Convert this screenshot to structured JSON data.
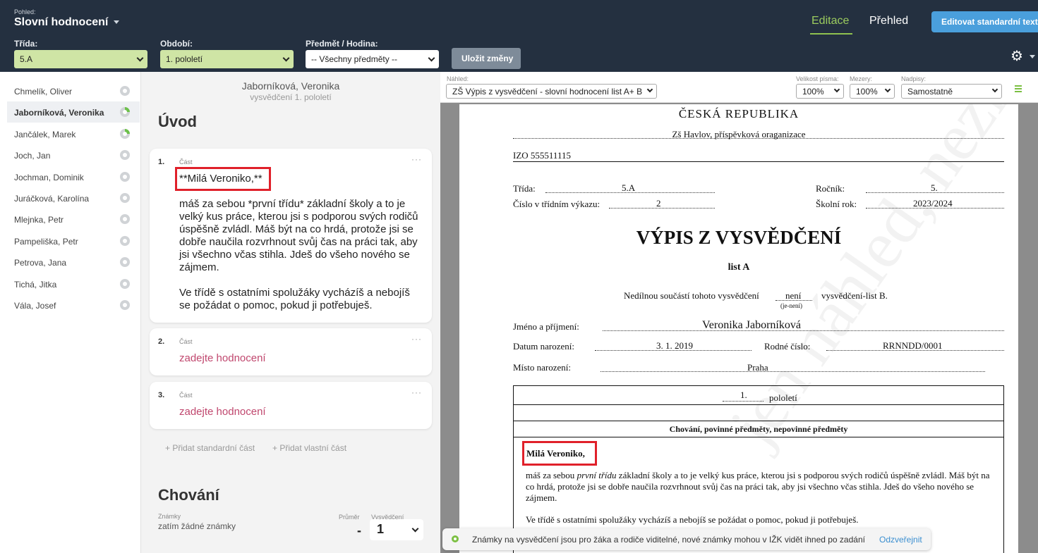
{
  "header": {
    "view_label": "Pohled:",
    "view_title": "Slovní hodnocení",
    "tab_edit": "Editace",
    "tab_overview": "Přehled",
    "btn_standard_texts": "Editovat standardní texty",
    "filters": {
      "class_label": "Třída:",
      "class_value": "5.A",
      "period_label": "Období:",
      "period_value": "1. pololetí",
      "subject_label": "Předmět / Hodina:",
      "subject_value": "-- Všechny předměty --"
    },
    "btn_save": "Uložit změny",
    "accent_green": "#8fc24f",
    "brand_blue": "#4a9fdc"
  },
  "students": [
    {
      "name": "Chmelík, Oliver",
      "status": "empty"
    },
    {
      "name": "Jaborníková, Veronika",
      "status": "partial",
      "active": true
    },
    {
      "name": "Jančálek, Marek",
      "status": "partial"
    },
    {
      "name": "Joch, Jan",
      "status": "empty"
    },
    {
      "name": "Jochman, Dominik",
      "status": "empty"
    },
    {
      "name": "Juráčková, Karolína",
      "status": "empty"
    },
    {
      "name": "Mlejnka, Petr",
      "status": "empty"
    },
    {
      "name": "Pampeliška, Petr",
      "status": "empty"
    },
    {
      "name": "Petrova, Jana",
      "status": "empty"
    },
    {
      "name": "Tichá, Jitka",
      "status": "empty"
    },
    {
      "name": "Vála, Josef",
      "status": "empty"
    }
  ],
  "editor": {
    "student_name": "Jaborníková, Veronika",
    "report_sub": "vysvědčení 1. pololetí",
    "section_intro": "Úvod",
    "cards": [
      {
        "num": "1.",
        "label": "Část",
        "more": "···",
        "greeting": "**Milá Veroniko,**",
        "para1": "máš za sebou *první třídu* základní školy a to je velký kus práce, kterou jsi s podporou svých rodičů úspěšně zvládl. Máš být na co hrdá, protože  jsi se  dobře naučila rozvrhnout svůj čas na práci tak, aby jsi všechno včas stihla. Jdeš do všeho nového se zájmem.",
        "para2": "Ve třídě s ostatními spolužáky vycházíš  a nebojíš se požádat o pomoc, pokud ji potřebuješ."
      },
      {
        "num": "2.",
        "label": "Část",
        "more": "···",
        "placeholder": "zadejte hodnocení"
      },
      {
        "num": "3.",
        "label": "Část",
        "more": "···",
        "placeholder": "zadejte hodnocení"
      }
    ],
    "add_standard": "Přidat standardní část",
    "add_custom": "Přidat vlastní část",
    "section_behavior": "Chování",
    "marks_label": "Známky",
    "no_marks": "zatím žádné známky",
    "average_label": "Průměr",
    "certificate_label": "Vysvědčení",
    "average_value": "-",
    "grade_value": "1"
  },
  "preview": {
    "preview_label": "Náhled:",
    "preview_value": "ZŠ Výpis z vysvědčení - slovní hodnocení list A+ B",
    "font_size_label": "Velikost písma:",
    "font_size_value": "100%",
    "spacing_label": "Mezery:",
    "spacing_value": "100%",
    "headings_label": "Nadpisy:",
    "headings_value": "Samostatně",
    "doc": {
      "country": "ČESKÁ REPUBLIKA",
      "school": "Zš Havlov, příspěvková oraganizace",
      "izo": "IZO  555511115",
      "class_label": "Třída:",
      "class_value": "5.A",
      "grade_label": "Ročník:",
      "grade_value": "5.",
      "register_label": "Číslo v třídním výkazu:",
      "register_value": "2",
      "year_label": "Školní rok:",
      "year_value": "2023/2024",
      "title": "VÝPIS Z VYSVĚDČENÍ",
      "subtitle": "list A",
      "inseparable": "Nedílnou součástí tohoto vysvědčení",
      "inseparable_value": "není",
      "inseparable_hint": "(je-není)",
      "inseparable_tail": "vysvědčení-list B.",
      "name_label": "Jméno a příjmení:",
      "name_value": "Veronika Jaborníková",
      "birth_label": "Datum narození:",
      "birth_value": "3. 1. 2019",
      "id_label": "Rodné číslo:",
      "id_value": "RRNNDD/0001",
      "place_label": "Místo narození:",
      "place_value": "Praha",
      "half_value": "1.",
      "half_label": "pololetí",
      "table_header": "Chování, povinné předměty, nepovinné předměty",
      "greeting": "Milá Veroniko,",
      "para1_a": "máš za sebou ",
      "para1_em": "první třídu",
      "para1_b": " základní školy a to je velký kus práce, kterou jsi s podporou svých rodičů úspěšně zvládl. Máš být na co hrdá, protože  jsi se  dobře naučila rozvrhnout svůj čas na práci tak, aby jsi všechno včas stihla. Jdeš do všeho nového se zájmem.",
      "para2": "Ve třídě s ostatními spolužáky vycházíš  a nebojíš se požádat o pomoc, pokud ji potřebuješ.",
      "watermark": "jen náhled, nezkinout"
    }
  },
  "toast": {
    "text": "Známky na vysvědčení jsou pro žáka a rodiče viditelné, nové známky mohou v IŽK vidět ihned po zadání",
    "link": "Odzveřejnit"
  }
}
